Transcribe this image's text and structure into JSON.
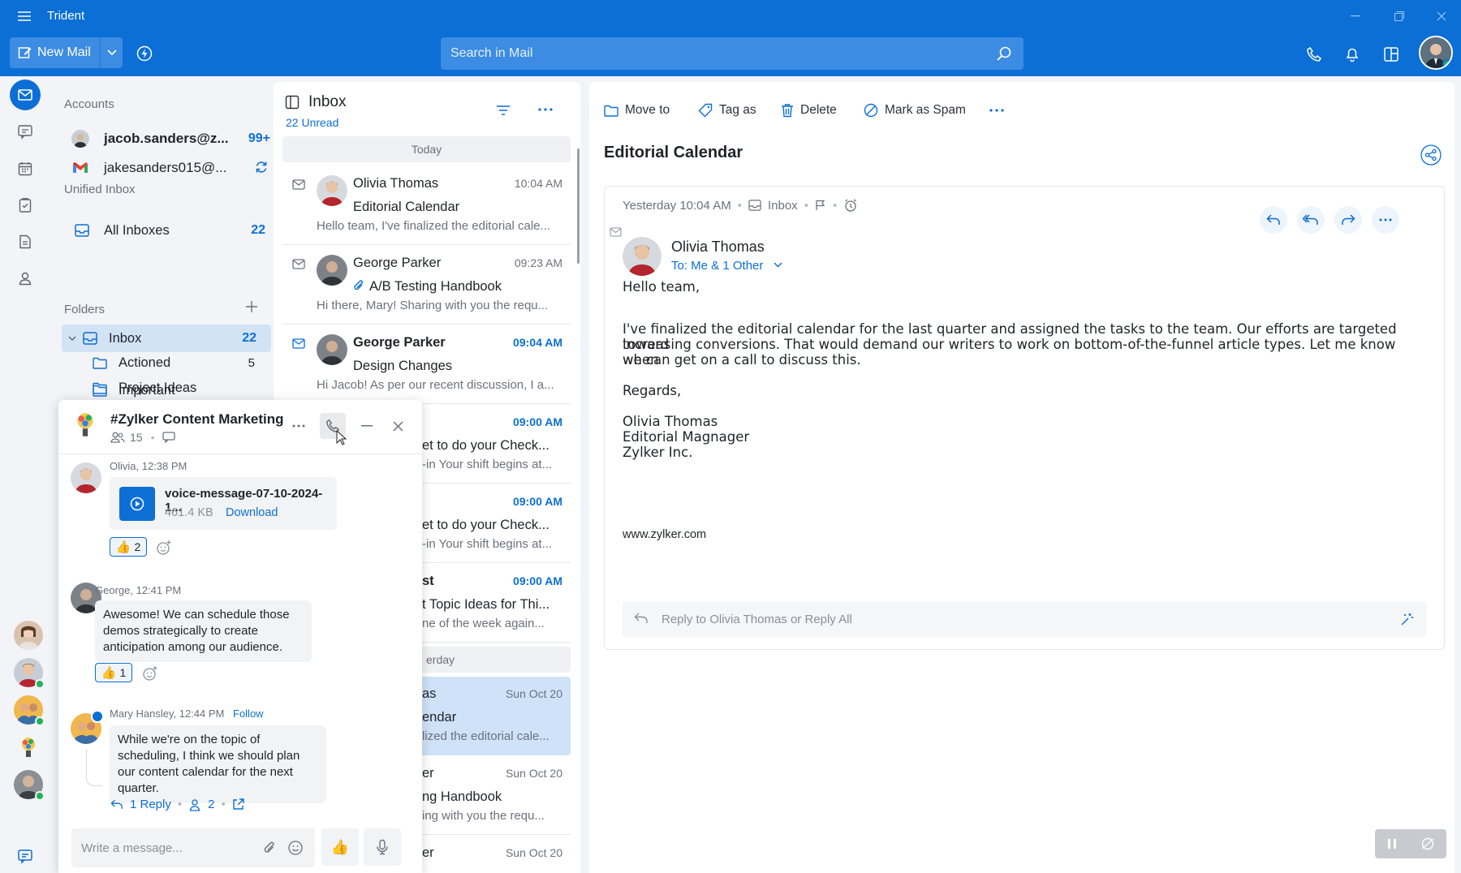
{
  "app": {
    "title": "Trident"
  },
  "toolbar": {
    "new_mail_label": "New Mail",
    "search_placeholder": "Search in Mail"
  },
  "nav": {
    "accounts_label": "Accounts",
    "accounts": [
      {
        "email": "jacob.sanders@z...",
        "count": "99+"
      },
      {
        "email": "jakesanders015@..."
      }
    ],
    "unified_label": "Unified Inbox",
    "all_inboxes": {
      "label": "All Inboxes",
      "count": "22"
    },
    "folders_label": "Folders",
    "inbox": {
      "label": "Inbox",
      "count": "22"
    },
    "subfolders": [
      {
        "label": "Actioned",
        "count": "5"
      },
      {
        "label": "Important",
        "count": ""
      },
      {
        "label": "Project Ideas",
        "count": ""
      }
    ]
  },
  "list": {
    "title": "Inbox",
    "unread": "22 Unread",
    "today_label": "Today",
    "yesterday_label": "erday",
    "items": [
      {
        "sender": "Olivia Thomas",
        "time": "10:04 AM",
        "subject": "Editorial Calendar",
        "preview": "Hello team, I've finalized the editorial cale..."
      },
      {
        "sender": "George Parker",
        "time": "09:23 AM",
        "subject": "A/B Testing Handbook",
        "preview": "Hi there, Mary! Sharing with you the requ..."
      },
      {
        "sender": "George Parker",
        "time": "09:04 AM",
        "subject": "Design Changes",
        "preview": "Hi Jacob! As per our recent discussion, I a..."
      },
      {
        "sender": "",
        "time": "09:00 AM",
        "subject": "et to do your Check...",
        "preview": "-in Your shift begins at..."
      },
      {
        "sender": "",
        "time": "09:00 AM",
        "subject": "et to do your Check...",
        "preview": "-in Your shift begins at..."
      },
      {
        "sender": "st",
        "time": "09:00 AM",
        "subject": "t Topic Ideas for Thi...",
        "preview": "ne of the week again..."
      },
      {
        "sender": "as",
        "time": "Sun Oct 20",
        "subject": "endar",
        "preview": "lized the editorial cale..."
      },
      {
        "sender": "er",
        "time": "Sun Oct 20",
        "subject": "ng Handbook",
        "preview": "ing with you the requ..."
      },
      {
        "sender": "er",
        "time": "Sun Oct 20",
        "subject": "",
        "preview": ""
      }
    ]
  },
  "reading": {
    "actions": {
      "move": "Move to",
      "tag": "Tag as",
      "delete": "Delete",
      "spam": "Mark as Spam"
    },
    "subject": "Editorial Calendar",
    "meta_time": "Yesterday 10:04 AM",
    "meta_folder": "Inbox",
    "from": "Olivia Thomas",
    "to": "To: Me & 1 Other",
    "body": {
      "greeting": "Hello team,",
      "p1": "I've finalized the editorial calendar for the last quarter and assigned the tasks to the team. Our efforts are targeted toward",
      "p2": "increasing conversions. That would demand our writers to work on bottom-of-the-funnel article types. Let me know when",
      "p3": "we can get on a call to discuss this.",
      "regards": "Regards,",
      "sig1": "Olivia Thomas",
      "sig2": "Editorial Magnager",
      "sig3": "Zylker Inc.",
      "link": "www.zylker.com"
    },
    "reply_placeholder": "Reply to Olivia Thomas or Reply All"
  },
  "chat": {
    "title": "#Zylker Content Marketing",
    "members": "15",
    "messages": [
      {
        "meta": "Olivia, 12:38 PM",
        "file_name": "voice-message-07-10-2024-1...",
        "file_size": "461.4 KB",
        "download": "Download",
        "reaction_count": "2"
      },
      {
        "meta": "George, 12:41 PM",
        "text": "Awesome!  We can schedule those demos strategically to create anticipation among our audience.",
        "reaction_count": "1"
      },
      {
        "meta": "Mary Hansley, 12:44 PM",
        "follow": "Follow",
        "text": "While we're on the topic of scheduling, I think we should plan our content calendar for the next quarter.",
        "reply": "1 Reply",
        "participants": "2"
      }
    ],
    "input_placeholder": "Write a message..."
  }
}
